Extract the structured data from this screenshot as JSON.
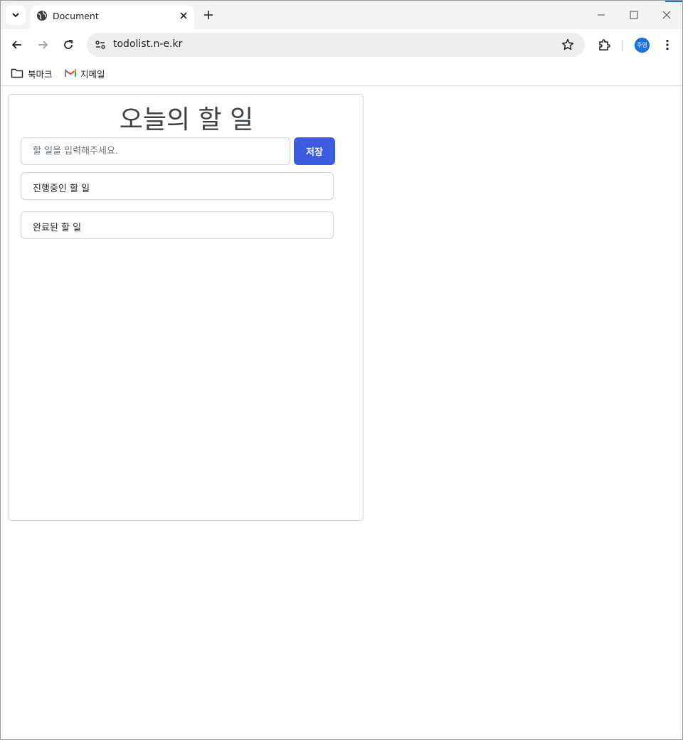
{
  "browser": {
    "tab": {
      "title": "Document"
    },
    "omnibox": {
      "url": "todolist.n-e.kr"
    },
    "profile": {
      "initials": "주영"
    },
    "bookmarks": [
      {
        "label": "북마크",
        "icon": "folder-icon"
      },
      {
        "label": "지메일",
        "icon": "gmail-icon"
      }
    ]
  },
  "page": {
    "title": "오늘의 할 일",
    "input": {
      "placeholder": "할 일을 입력해주세요.",
      "value": ""
    },
    "save_label": "저장",
    "sections": {
      "in_progress": "진행중인 할 일",
      "completed": "완료된 할 일"
    }
  },
  "colors": {
    "primary_button": "#3b5ce0",
    "tab_strip": "#f3f3f3",
    "omnibox": "#efeded",
    "avatar": "#1a73e8"
  }
}
